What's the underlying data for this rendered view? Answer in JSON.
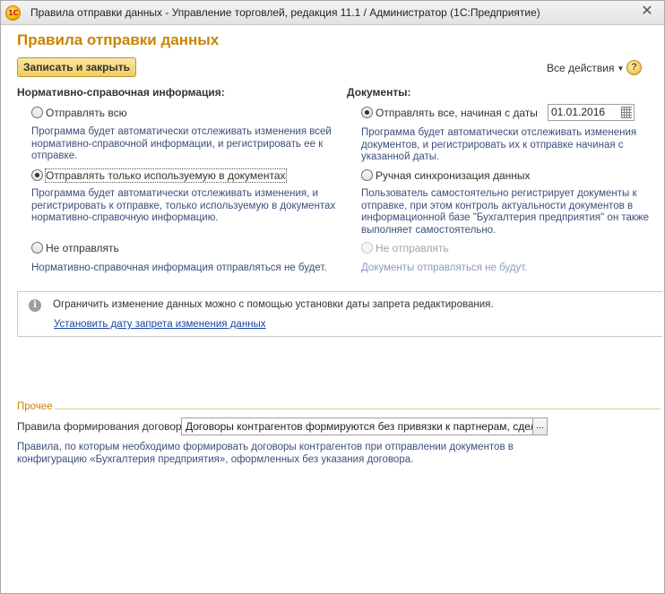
{
  "window": {
    "title": "Правила отправки данных - Управление торговлей, редакция 11.1 / Администратор  (1С:Предприятие)",
    "app_icon_text": "1С",
    "close_glyph": "✕"
  },
  "page_title": "Правила отправки данных",
  "toolbar": {
    "save_close_label": "Записать и закрыть",
    "all_actions_label": "Все действия",
    "help_glyph": "?"
  },
  "nsi": {
    "heading": "Нормативно-справочная информация:",
    "options": [
      {
        "label": "Отправлять всю",
        "checked": false,
        "description": "Программа будет автоматически отслеживать изменения всей нормативно-справочной информации, и регистрировать ее к отправке."
      },
      {
        "label": "Отправлять только используемую в документах",
        "checked": true,
        "description": "Программа будет автоматически отслеживать изменения, и регистрировать к отправке, только используемую в документах нормативно-справочную информацию."
      },
      {
        "label": "Не отправлять",
        "checked": false,
        "description": "Нормативно-справочная информация отправляться не будет."
      }
    ]
  },
  "docs": {
    "heading": "Документы:",
    "date_value": "01.01.2016",
    "options": [
      {
        "label": "Отправлять все, начиная с даты",
        "checked": true,
        "description": "Программа будет автоматически отслеживать изменения документов, и регистрировать их к отправке начиная с указанной даты."
      },
      {
        "label": "Ручная синхронизация данных",
        "checked": false,
        "description": "Пользователь самостоятельно регистрирует документы к отправке, при этом контроль актуальности документов в информационной базе \"Бухгалтерия предприятия\" он также выполняет самостоятельно."
      },
      {
        "label": "Не отправлять",
        "checked": false,
        "disabled": true,
        "description": "Документы отправляться не будут."
      }
    ]
  },
  "info": {
    "icon_glyph": "i",
    "text": "Ограничить изменение данных можно с помощью установки даты запрета редактирования.",
    "link": "Установить дату запрета изменения данных"
  },
  "other": {
    "group_title": "Прочее",
    "contracts_label": "Правила формирования договоров:",
    "contracts_value": "Договоры контрагентов формируются без привязки к партнерам, сделкам",
    "select_glyph": "...",
    "description": "Правила, по которым необходимо формировать договоры контрагентов при отправлении документов в конфигурацию «Бухгалтерия предприятия», оформленных без указания договора."
  }
}
